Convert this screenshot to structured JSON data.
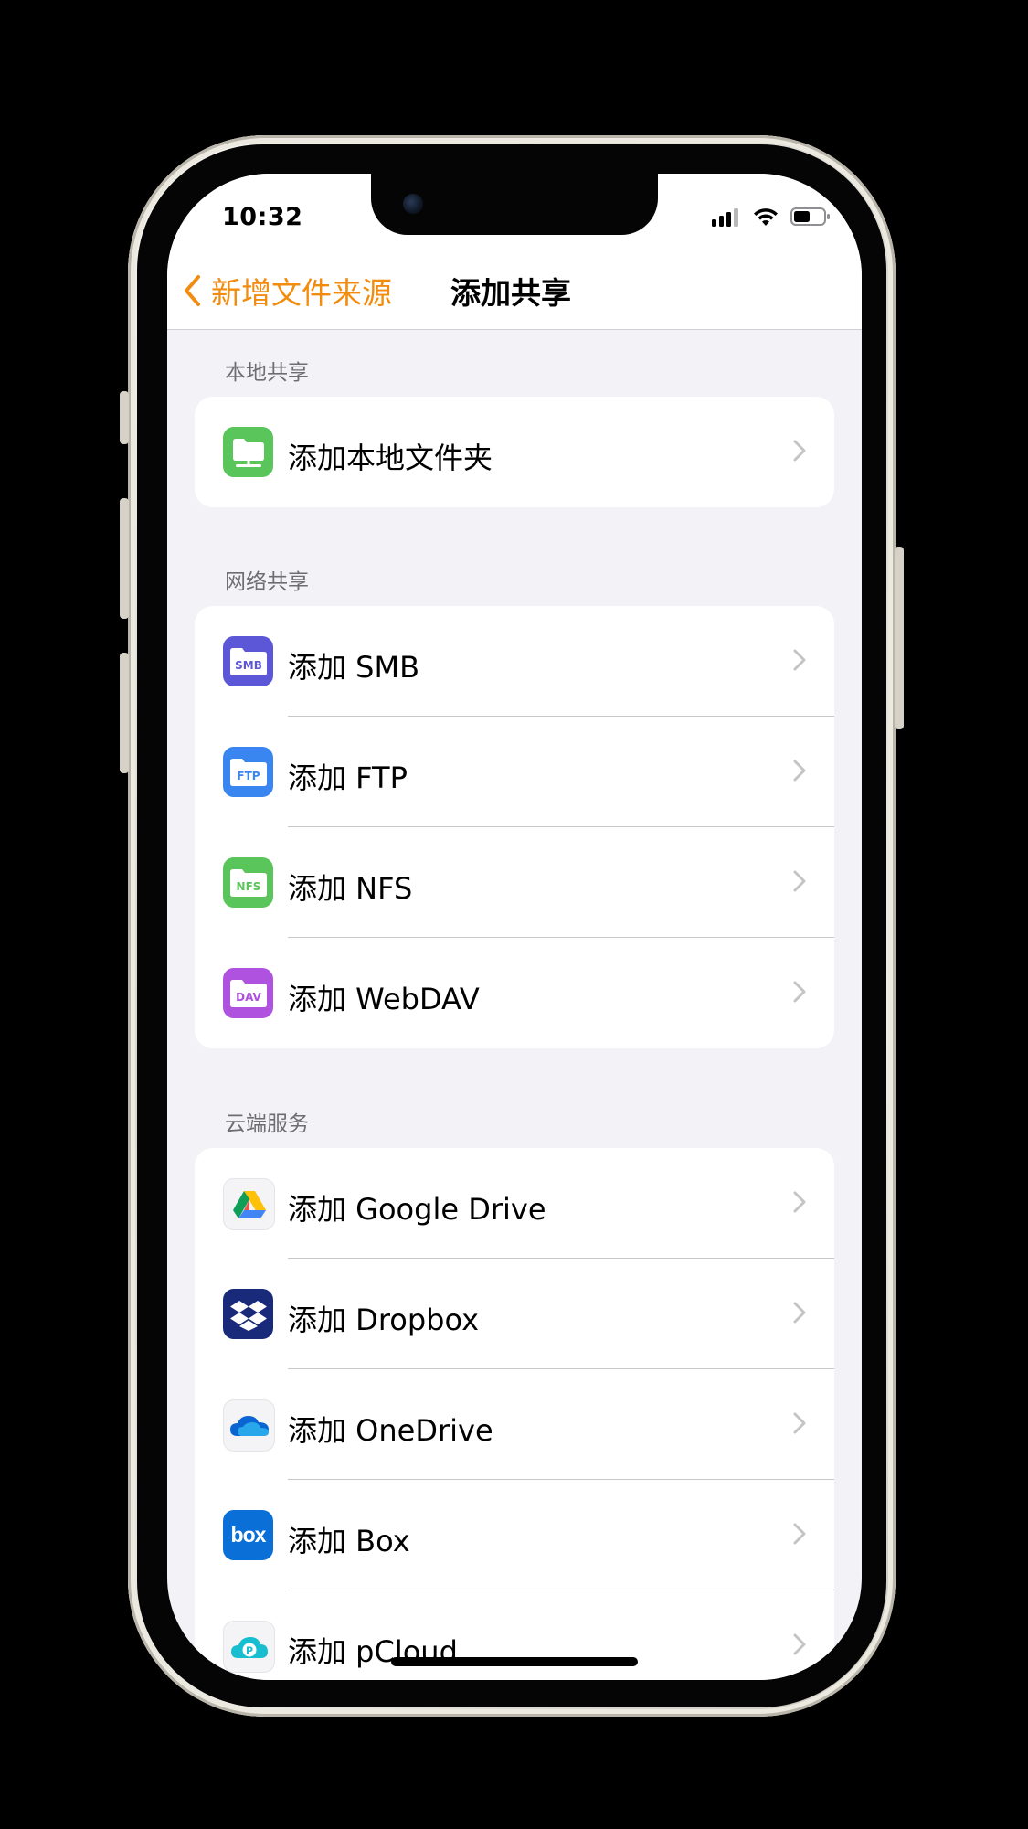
{
  "status_bar": {
    "time": "10:32"
  },
  "nav": {
    "back_label": "新增文件来源",
    "title": "添加共享"
  },
  "colors": {
    "accent": "#f28c0f"
  },
  "sections": [
    {
      "header": "本地共享",
      "items": [
        {
          "label": "添加本地文件夹",
          "icon": "local-folder-icon"
        }
      ]
    },
    {
      "header": "网络共享",
      "items": [
        {
          "label": "添加 SMB",
          "icon": "smb-folder-icon",
          "badge": "SMB"
        },
        {
          "label": "添加 FTP",
          "icon": "ftp-folder-icon",
          "badge": "FTP"
        },
        {
          "label": "添加 NFS",
          "icon": "nfs-folder-icon",
          "badge": "NFS"
        },
        {
          "label": "添加 WebDAV",
          "icon": "webdav-folder-icon",
          "badge": "DAV"
        }
      ]
    },
    {
      "header": "云端服务",
      "items": [
        {
          "label": "添加 Google Drive",
          "icon": "google-drive-icon"
        },
        {
          "label": "添加 Dropbox",
          "icon": "dropbox-icon"
        },
        {
          "label": "添加 OneDrive",
          "icon": "onedrive-icon"
        },
        {
          "label": "添加 Box",
          "icon": "box-icon",
          "badge": "box"
        },
        {
          "label": "添加 pCloud",
          "icon": "pcloud-icon",
          "badge": "P"
        }
      ]
    }
  ]
}
